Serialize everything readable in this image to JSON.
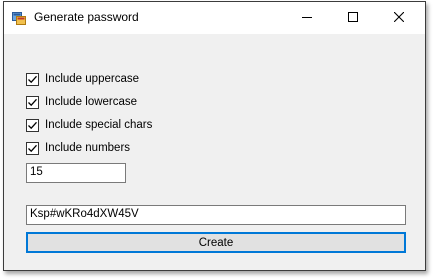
{
  "window": {
    "title": "Generate password"
  },
  "icons": {
    "app": "app-icon",
    "minimize": "minimize-icon",
    "maximize": "maximize-icon",
    "close": "close-icon"
  },
  "options": [
    {
      "label": "Include uppercase",
      "checked": true
    },
    {
      "label": "Include lowercase",
      "checked": true
    },
    {
      "label": "Include special chars",
      "checked": true
    },
    {
      "label": "Include numbers",
      "checked": true
    }
  ],
  "length_input": {
    "value": "15"
  },
  "password_output": {
    "value": "Ksp#wKRo4dXW45V"
  },
  "create_button": {
    "label": "Create"
  },
  "colors": {
    "accent": "#0078d7",
    "window_bg": "#f0f0f0"
  }
}
